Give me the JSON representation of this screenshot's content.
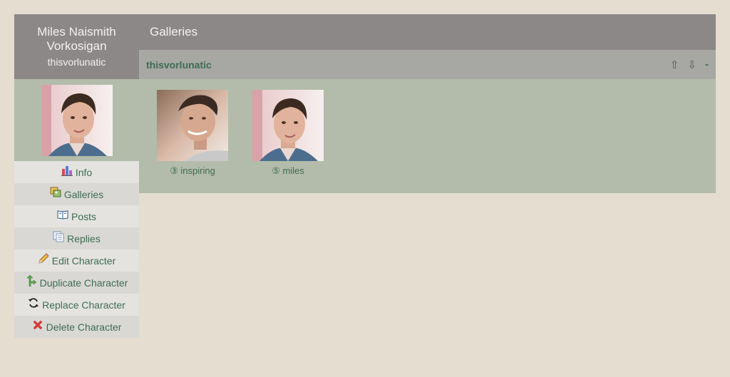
{
  "character": {
    "name": "Miles Naismith Vorkosigan",
    "screenname": "thisvorlunatic"
  },
  "menu": [
    {
      "label": "Info",
      "icon": "chart-icon"
    },
    {
      "label": "Galleries",
      "icon": "galleries-icon"
    },
    {
      "label": "Posts",
      "icon": "book-icon"
    },
    {
      "label": "Replies",
      "icon": "replies-icon"
    },
    {
      "label": "Edit Character",
      "icon": "pencil-icon"
    },
    {
      "label": "Duplicate Character",
      "icon": "duplicate-icon"
    },
    {
      "label": "Replace Character",
      "icon": "refresh-icon"
    },
    {
      "label": "Delete Character",
      "icon": "delete-icon"
    }
  ],
  "main": {
    "title": "Galleries",
    "gallery": {
      "name": "thisvorlunatic",
      "controls": {
        "up": "⇧",
        "down": "⇩",
        "collapse": "-"
      },
      "icons": [
        {
          "caption": "③ inspiring"
        },
        {
          "caption": "⑤ miles"
        }
      ]
    }
  },
  "colors": {
    "header_bg": "#8c8888",
    "panel_bg": "#b3bcaa",
    "page_bg": "#e4ddd0",
    "link": "#3f6b53"
  }
}
